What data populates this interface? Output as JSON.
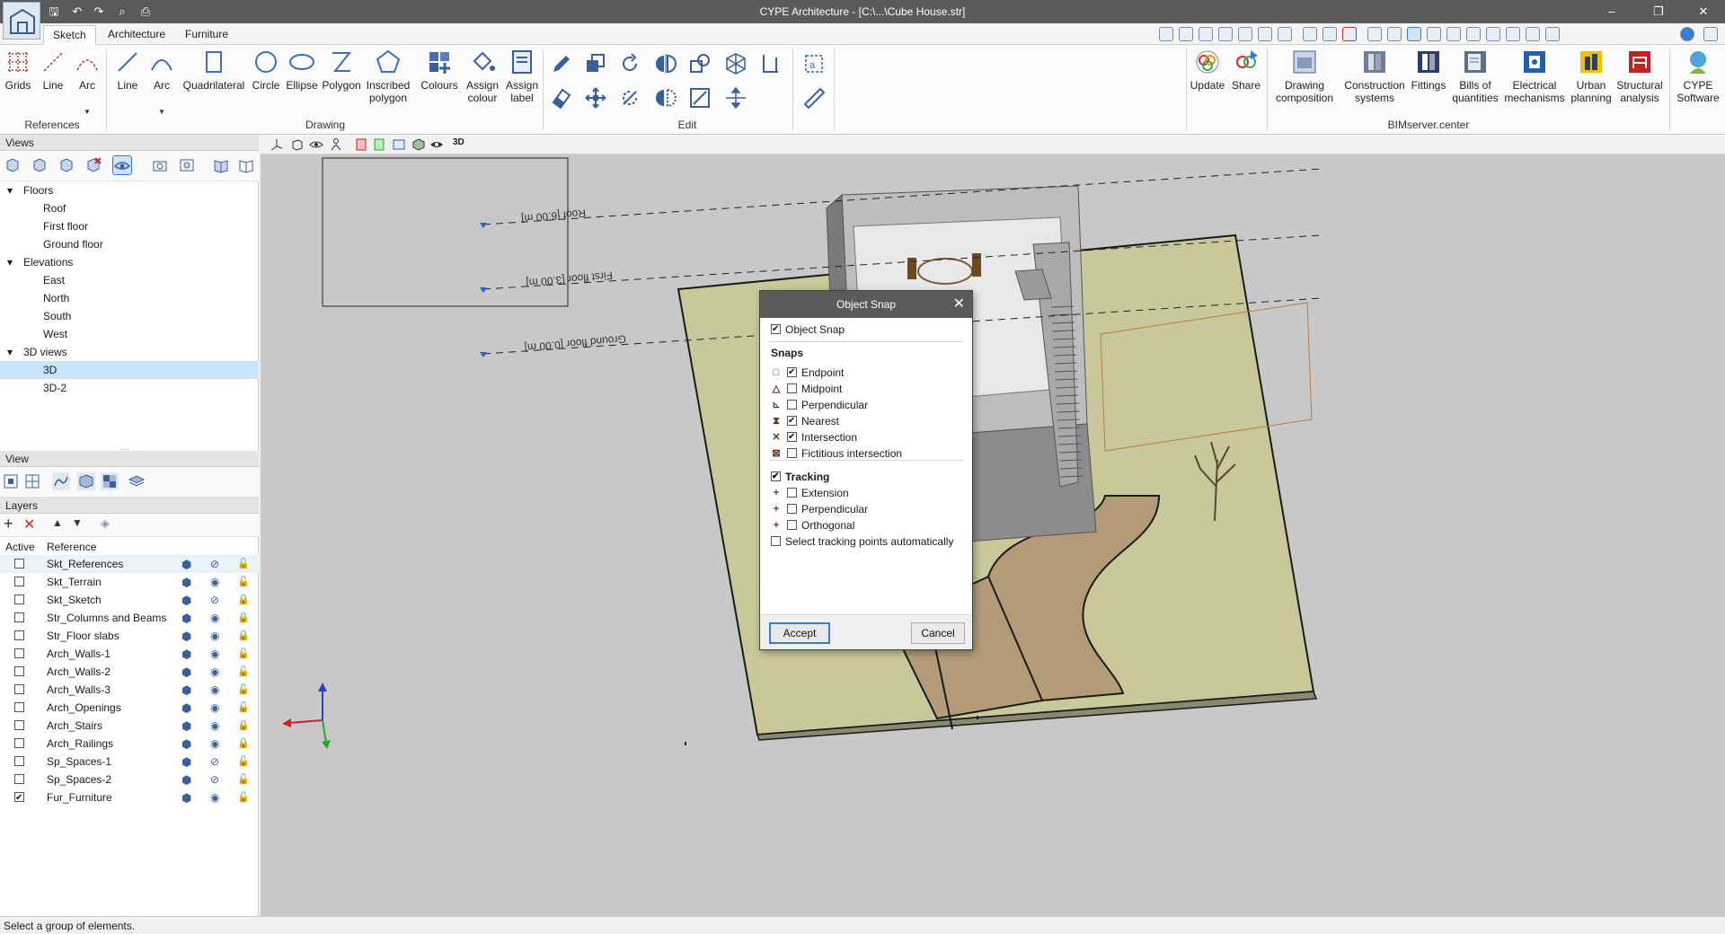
{
  "app": {
    "title": "CYPE Architecture - [C:\\...\\Cube House.str]"
  },
  "tabs": [
    {
      "label": "Sketch",
      "active": true
    },
    {
      "label": "Architecture",
      "active": false
    },
    {
      "label": "Furniture",
      "active": false
    }
  ],
  "ribbon": {
    "references": {
      "label": "References",
      "buttons": [
        {
          "label": "Grids"
        },
        {
          "label": "Line"
        },
        {
          "label": "Arc"
        }
      ]
    },
    "drawing": {
      "label": "Drawing",
      "buttons": [
        {
          "label": "Line"
        },
        {
          "label": "Arc"
        },
        {
          "label": "Quadrilateral"
        },
        {
          "label": "Circle"
        },
        {
          "label": "Ellipse"
        },
        {
          "label": "Polygon"
        },
        {
          "label": "Inscribed polygon"
        },
        {
          "label": "Colours"
        },
        {
          "label": "Assign colour"
        },
        {
          "label": "Assign label"
        }
      ]
    },
    "edit": {
      "label": "Edit"
    },
    "bimserver": {
      "label": "BIMserver.center",
      "buttons": [
        {
          "label": "Update"
        },
        {
          "label": "Share"
        },
        {
          "label": "Drawing composition"
        },
        {
          "label": "Construction systems"
        },
        {
          "label": "Fittings"
        },
        {
          "label": "Bills of quantities"
        },
        {
          "label": "Electrical mechanisms"
        },
        {
          "label": "Urban planning"
        },
        {
          "label": "Structural analysis"
        },
        {
          "label": "CYPE Software"
        }
      ]
    }
  },
  "views_panel": {
    "title": "Views",
    "groups": [
      {
        "label": "Floors",
        "items": [
          "Roof",
          "First floor",
          "Ground floor"
        ]
      },
      {
        "label": "Elevations",
        "items": [
          "East",
          "North",
          "South",
          "West"
        ]
      },
      {
        "label": "3D views",
        "items": [
          "3D",
          "3D-2"
        ]
      }
    ],
    "selected": "3D"
  },
  "view_panel": {
    "title": "View"
  },
  "layers_panel": {
    "title": "Layers",
    "col_active": "Active",
    "col_reference": "Reference",
    "rows": [
      {
        "name": "Skt_References",
        "active": false,
        "visible": false,
        "locked": false
      },
      {
        "name": "Skt_Terrain",
        "active": false,
        "visible": true,
        "locked": false
      },
      {
        "name": "Skt_Sketch",
        "active": false,
        "visible": false,
        "locked": true
      },
      {
        "name": "Str_Columns and Beams",
        "active": false,
        "visible": true,
        "locked": true
      },
      {
        "name": "Str_Floor slabs",
        "active": false,
        "visible": true,
        "locked": true
      },
      {
        "name": "Arch_Walls-1",
        "active": false,
        "visible": true,
        "locked": false
      },
      {
        "name": "Arch_Walls-2",
        "active": false,
        "visible": true,
        "locked": false
      },
      {
        "name": "Arch_Walls-3",
        "active": false,
        "visible": true,
        "locked": false
      },
      {
        "name": "Arch_Openings",
        "active": false,
        "visible": true,
        "locked": false
      },
      {
        "name": "Arch_Stairs",
        "active": false,
        "visible": true,
        "locked": true
      },
      {
        "name": "Arch_Railings",
        "active": false,
        "visible": true,
        "locked": true
      },
      {
        "name": "Sp_Spaces-1",
        "active": false,
        "visible": false,
        "locked": false
      },
      {
        "name": "Sp_Spaces-2",
        "active": false,
        "visible": false,
        "locked": false
      },
      {
        "name": "Fur_Furniture",
        "active": true,
        "visible": true,
        "locked": false
      }
    ]
  },
  "viewport": {
    "level_labels": [
      "Roof [6.00 m]",
      "First floor [3.00 m]",
      "Ground floor [0.00 m]"
    ]
  },
  "dialog": {
    "title": "Object Snap",
    "object_snap_label": "Object Snap",
    "object_snap_checked": true,
    "snaps_header": "Snaps",
    "snaps": [
      {
        "label": "Endpoint",
        "checked": true,
        "symbol": "□"
      },
      {
        "label": "Midpoint",
        "checked": false,
        "symbol": "△"
      },
      {
        "label": "Perpendicular",
        "checked": false,
        "symbol": "⊾"
      },
      {
        "label": "Nearest",
        "checked": true,
        "symbol": "⧗"
      },
      {
        "label": "Intersection",
        "checked": true,
        "symbol": "✕"
      },
      {
        "label": "Fictitious intersection",
        "checked": false,
        "symbol": "⊠"
      }
    ],
    "tracking_label": "Tracking",
    "tracking_checked": true,
    "tracking": [
      {
        "label": "Extension",
        "checked": false,
        "symbol": "+"
      },
      {
        "label": "Perpendicular",
        "checked": false,
        "symbol": "+"
      },
      {
        "label": "Orthogonal",
        "checked": false,
        "symbol": "+"
      }
    ],
    "auto_tracking_label": "Select tracking points automatically",
    "auto_tracking_checked": false,
    "accept_label": "Accept",
    "cancel_label": "Cancel"
  },
  "status": {
    "text": "Select a group of elements."
  },
  "colors": {
    "titlebar": "#5b5b5b",
    "accent": "#3a7bd5",
    "terrain": "#c9c89a",
    "path": "#b39b78",
    "wall": "#8c8c8c"
  }
}
